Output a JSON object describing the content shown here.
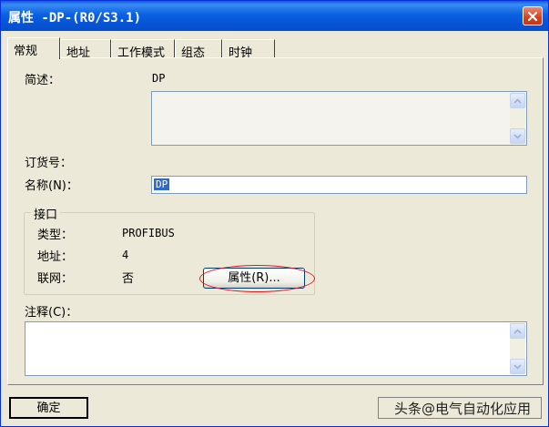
{
  "window": {
    "title": "属性 -DP-(R0/S3.1)"
  },
  "tabs": [
    {
      "label": "常规"
    },
    {
      "label": "地址"
    },
    {
      "label": "工作模式"
    },
    {
      "label": "组态"
    },
    {
      "label": "时钟"
    }
  ],
  "general": {
    "desc_label": "简述：",
    "desc_value": "DP",
    "order_label": "订货号：",
    "name_label": "名称(N)：",
    "name_value": "DP"
  },
  "interface": {
    "title": "接口",
    "type_label": "类型：",
    "type_value": "PROFIBUS",
    "address_label": "地址：",
    "address_value": "4",
    "network_label": "联网：",
    "network_value": "否",
    "properties_button": "属性(R)..."
  },
  "comment": {
    "label": "注释(C)：",
    "value": ""
  },
  "footer": {
    "ok_label": "确定",
    "watermark": "头条@电气自动化应用"
  },
  "colors": {
    "title_bar": "#0b61e2",
    "highlight": "#316ac5",
    "annotation": "#e0191b"
  }
}
